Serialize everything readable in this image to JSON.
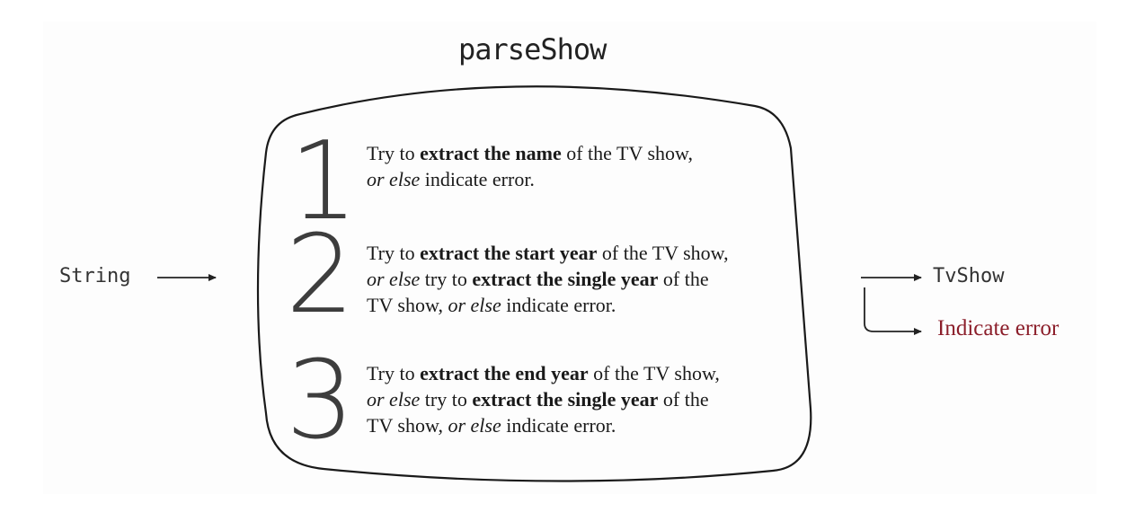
{
  "title": "parseShow",
  "input_label": "String",
  "outputs": {
    "success_label": "TvShow",
    "error_label": "Indicate error",
    "error_color": "#8b1e2a"
  },
  "steps": [
    {
      "number": "1",
      "lines": [
        [
          {
            "text": "Try to ",
            "style": "normal"
          },
          {
            "text": "extract the name",
            "style": "bold"
          },
          {
            "text": " of the TV show,",
            "style": "normal"
          }
        ],
        [
          {
            "text": "or else",
            "style": "italic"
          },
          {
            "text": " indicate error.",
            "style": "normal"
          }
        ]
      ]
    },
    {
      "number": "2",
      "lines": [
        [
          {
            "text": "Try to ",
            "style": "normal"
          },
          {
            "text": "extract the start year",
            "style": "bold"
          },
          {
            "text": " of the TV show,",
            "style": "normal"
          }
        ],
        [
          {
            "text": "or else",
            "style": "italic"
          },
          {
            "text": " try to ",
            "style": "normal"
          },
          {
            "text": "extract the single year",
            "style": "bold"
          },
          {
            "text": " of the",
            "style": "normal"
          }
        ],
        [
          {
            "text": "TV show, ",
            "style": "normal"
          },
          {
            "text": "or else",
            "style": "italic"
          },
          {
            "text": " indicate error.",
            "style": "normal"
          }
        ]
      ]
    },
    {
      "number": "3",
      "lines": [
        [
          {
            "text": "Try to ",
            "style": "normal"
          },
          {
            "text": "extract the end year",
            "style": "bold"
          },
          {
            "text": " of the TV show,",
            "style": "normal"
          }
        ],
        [
          {
            "text": "or else",
            "style": "italic"
          },
          {
            "text": " try to ",
            "style": "normal"
          },
          {
            "text": "extract the single year",
            "style": "bold"
          },
          {
            "text": " of the",
            "style": "normal"
          }
        ],
        [
          {
            "text": "TV show, ",
            "style": "normal"
          },
          {
            "text": "or else",
            "style": "italic"
          },
          {
            "text": " indicate error.",
            "style": "normal"
          }
        ]
      ]
    }
  ]
}
